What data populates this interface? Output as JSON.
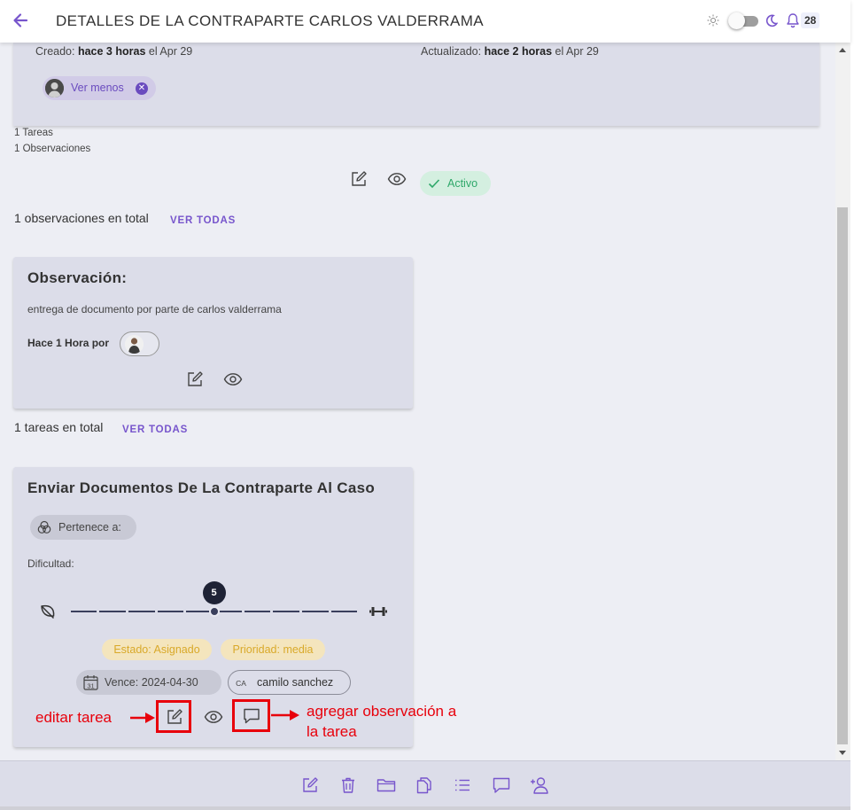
{
  "header": {
    "title": "DETALLES DE LA CONTRAPARTE CARLOS VALDERRAMA",
    "notifications_count": "28"
  },
  "meta": {
    "created_label": "Creado:",
    "created_ago": "hace 3 horas",
    "created_date": "el Apr 29",
    "updated_label": "Actualizado:",
    "updated_ago": "hace 2 horas",
    "updated_date": "el Apr 29",
    "ver_menos": "Ver menos"
  },
  "counts": {
    "tareas": "1 Tareas",
    "observaciones": "1 Observaciones"
  },
  "status": {
    "label": "Activo",
    "color": "#2fa86a"
  },
  "observations": {
    "total_text": "1 observaciones en total",
    "ver_todas": "VER TODAS",
    "card": {
      "title": "Observación:",
      "text": "entrega de documento por parte de carlos valderrama",
      "by": "Hace 1 Hora por"
    }
  },
  "tasks": {
    "total_text": "1 tareas en total",
    "ver_todas": "VER TODAS",
    "card": {
      "title": "Enviar Documentos De La Contraparte Al Caso",
      "pertenece": "Pertenece a:",
      "dificultad_label": "Dificultad:",
      "dificultad_value": 5,
      "dificultad_max": 10,
      "estado": "Estado: Asignado",
      "prioridad": "Prioridad: media",
      "vence": "Vence: 2024-04-30",
      "calendar_day": "31",
      "assignee_initials": "CA",
      "assignee": "camilo sanchez"
    }
  },
  "annotations": {
    "editar": "editar tarea",
    "agregar_line1": "agregar observación a",
    "agregar_line2": "la tarea",
    "color": "#e8000b"
  },
  "icons": {
    "header": [
      "back-arrow-icon",
      "sun-icon",
      "moon-icon",
      "bell-icon"
    ],
    "bottom_toolbar": [
      "edit-icon",
      "trash-icon",
      "folder-icon",
      "copy-icon",
      "list-icon",
      "comment-icon",
      "add-user-icon"
    ]
  },
  "colors": {
    "accent": "#7755cc",
    "card_bg": "#dcdde9",
    "page_bg": "#edeef4",
    "warning_chip": "#d9a92a"
  }
}
